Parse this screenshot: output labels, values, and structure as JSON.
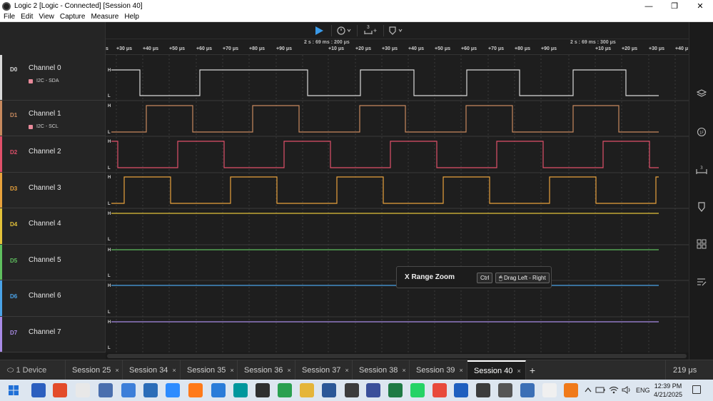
{
  "window": {
    "title": "Logic 2 [Logic - Connected] [Session 40]",
    "controls": [
      "—",
      "❐",
      "✕"
    ]
  },
  "menu": [
    "File",
    "Edit",
    "View",
    "Capture",
    "Measure",
    "Help"
  ],
  "toolbar": {
    "play_icon": "play-icon",
    "trigger_icon": "trigger-icon",
    "measure_label": "3",
    "measure_plus": "+",
    "marker_icon": "marker-icon"
  },
  "timeline": {
    "abs_labels": [
      {
        "text": "2 s : 69 ms : 200 μs"
      },
      {
        "text": "2 s : 69 ms : 300 μs"
      }
    ],
    "ticks": [
      "s",
      "+30 μs",
      "+40 μs",
      "+50 μs",
      "+60 μs",
      "+70 μs",
      "+80 μs",
      "+90 μs",
      "+10 μs",
      "+20 μs",
      "+30 μs",
      "+40 μs",
      "+50 μs",
      "+60 μs",
      "+70 μs",
      "+80 μs",
      "+90 μs",
      "+10 μs",
      "+20 μs",
      "+30 μs",
      "+40 μ"
    ]
  },
  "channels": [
    {
      "id": "D0",
      "name": "Channel 0",
      "analyzer": "I2C - SDA",
      "color": "#d9d9d9"
    },
    {
      "id": "D1",
      "name": "Channel 1",
      "analyzer": "I2C - SCL",
      "color": "#c7895e"
    },
    {
      "id": "D2",
      "name": "Channel 2",
      "analyzer": "",
      "color": "#e0506a"
    },
    {
      "id": "D3",
      "name": "Channel 3",
      "analyzer": "",
      "color": "#e8a23c"
    },
    {
      "id": "D4",
      "name": "Channel 4",
      "analyzer": "",
      "color": "#e3c23a"
    },
    {
      "id": "D5",
      "name": "Channel 5",
      "analyzer": "",
      "color": "#5fbf5f"
    },
    {
      "id": "D6",
      "name": "Channel 6",
      "analyzer": "",
      "color": "#4aa3e8"
    },
    {
      "id": "D7",
      "name": "Channel 7",
      "analyzer": "",
      "color": "#a98be6"
    }
  ],
  "level_labels": {
    "high": "H",
    "low": "L"
  },
  "tooltip": {
    "title": "X Range Zoom",
    "key": "Ctrl",
    "action": "🖱 Drag Left - Right"
  },
  "tabs": {
    "device": "⬭ 1 Device",
    "sessions": [
      "Session 25",
      "Session 34",
      "Session 35",
      "Session 36",
      "Session 37",
      "Session 38",
      "Session 39",
      "Session 40"
    ],
    "active": "Session 40",
    "close": "×",
    "add": "+",
    "zoom": "219 μs"
  },
  "right_sidebar": [
    "analyzers-icon",
    "extensions-icon",
    "measurements-icon",
    "markers-icon",
    "layout-icon",
    "notes-icon"
  ],
  "taskbar": {
    "apps": [
      "start-icon",
      "notion-icon",
      "figma-icon",
      "notepad-icon",
      "bug-icon",
      "store-icon",
      "terminal-icon",
      "zoom-icon",
      "firefox-icon",
      "vscode-icon",
      "arduino-icon",
      "shield-icon",
      "edge-icon",
      "folder-icon",
      "word-icon",
      "logic-icon",
      "media-icon",
      "excel-icon",
      "whatsapp-icon",
      "chrome-icon",
      "ide-icon",
      "obs-icon",
      "books-icon",
      "calculator-icon",
      "document-icon",
      "vlc-icon"
    ],
    "tray_lang": "ENG",
    "time": "12:39 PM",
    "date": "4/21/2025"
  }
}
